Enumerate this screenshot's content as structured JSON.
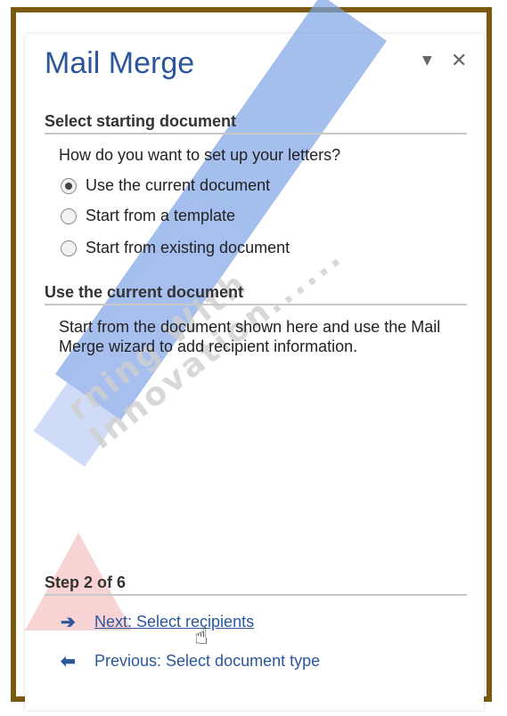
{
  "pane": {
    "title": "Mail Merge",
    "menu_icon": "dropdown-arrow-icon",
    "close_icon": "close-icon"
  },
  "section1": {
    "header": "Select starting document",
    "question": "How do you want to set up your letters?",
    "options": [
      {
        "label": "Use the current document",
        "checked": true
      },
      {
        "label": "Start from a template",
        "checked": false
      },
      {
        "label": "Start from existing document",
        "checked": false
      }
    ]
  },
  "section2": {
    "header": "Use the current document",
    "description": "Start from the document shown here and use the Mail Merge wizard to add recipient information."
  },
  "footer": {
    "step": "Step 2 of 6",
    "next": "Next: Select recipients",
    "previous": "Previous: Select document type"
  },
  "watermark": {
    "text": "rning With Innovation......"
  },
  "colors": {
    "accent": "#2b579a",
    "frame": "#7a5a12"
  }
}
